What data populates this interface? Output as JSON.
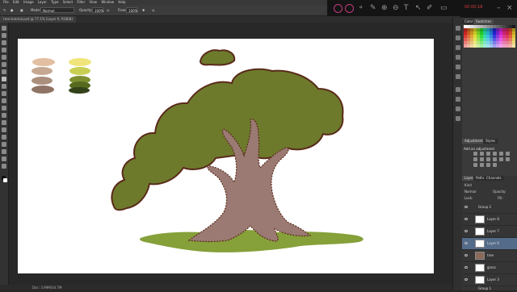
{
  "menubar": {
    "items": [
      "File",
      "Edit",
      "Image",
      "Layer",
      "Type",
      "Select",
      "Filter",
      "View",
      "Window",
      "Help"
    ]
  },
  "options": {
    "mode_label": "Mode:",
    "mode_value": "Normal",
    "opacity_label": "Opacity:",
    "opacity_value": "100%",
    "flow_label": "Flow:",
    "flow_value": "100%"
  },
  "recorder": {
    "timer": "00:00:18"
  },
  "document": {
    "tab_title": "tree-tutorial.psd @ 77.1% (Layer 6, RGB/8)"
  },
  "status": {
    "text": "Doc: 3.99M/34.7M"
  },
  "panels": {
    "color_tab": "Color",
    "swatches_tab": "Swatches",
    "adjustments_tab": "Adjustments",
    "styles_tab": "Styles",
    "adjust_hint": "Add an adjustment",
    "layers_tab": "Layers",
    "paths_tab": "Paths",
    "channels_tab": "Channels",
    "kind_label": "Kind",
    "blend_mode": "Normal",
    "opacity_label": "Opacity:",
    "lock_label": "Lock:",
    "fill_label": "Fill:"
  },
  "layers": [
    {
      "name": "Group 2",
      "type": "group"
    },
    {
      "name": "Layer 8",
      "type": "layer"
    },
    {
      "name": "Layer 7",
      "type": "layer"
    },
    {
      "name": "Layer 6",
      "type": "layer",
      "selected": true
    },
    {
      "name": "tree",
      "type": "layer"
    },
    {
      "name": "grass",
      "type": "layer"
    },
    {
      "name": "Layer 3",
      "type": "layer"
    },
    {
      "name": "Group 1",
      "type": "group"
    }
  ],
  "palette": {
    "skin": [
      "#e3bfa2",
      "#c6a791",
      "#ab8f7d",
      "#8f7466"
    ],
    "greens": [
      "#efe57a",
      "#c8cf53",
      "#7d8f30",
      "#556a1e",
      "#34421a"
    ]
  },
  "colors": {
    "foliage": "#6d7a2c",
    "outline": "#5a2a1a",
    "trunk": "#9a7a72",
    "grass": "#86a03a"
  }
}
